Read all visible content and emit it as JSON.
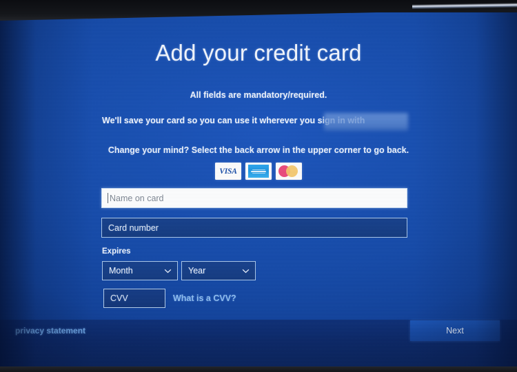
{
  "screen": {
    "title": "Add your credit card",
    "subtitle": "All fields are mandatory/required.",
    "save_line": "We'll save your card so you can use it wherever you sign in with",
    "redacted_note": "",
    "change_line": "Change your mind? Select the back arrow in the upper corner to go back."
  },
  "card_logos": [
    {
      "name": "visa-logo",
      "label": "VISA"
    },
    {
      "name": "amex-logo",
      "label": "AMERICAN EXPRESS"
    },
    {
      "name": "mastercard-logo",
      "label": "Mastercard"
    }
  ],
  "form": {
    "name_on_card": {
      "value": "",
      "placeholder": "Name on card",
      "focused": true
    },
    "card_number": {
      "value": "",
      "placeholder": "Card number",
      "focused": false
    },
    "expires_label": "Expires",
    "month": {
      "selected": "Month"
    },
    "year": {
      "selected": "Year"
    },
    "cvv": {
      "value": "",
      "placeholder": "CVV",
      "focused": false
    },
    "cvv_help_link": "What is a CVV?"
  },
  "footer": {
    "privacy_link": "privacy statement",
    "next_label": "Next"
  },
  "colors": {
    "background_blue": "#1449a8",
    "footer_navy": "#0a2768",
    "accent_link": "#8ebdf0",
    "privacy_link": "#6fa9ea",
    "button_blue": "#1549a5",
    "field_white": "#fdfeff",
    "visa_blue": "#1a4ea8",
    "amex_blue": "#1f97e2",
    "mastercard_red": "#ea4a7c",
    "mastercard_yellow": "#f5c76a"
  }
}
